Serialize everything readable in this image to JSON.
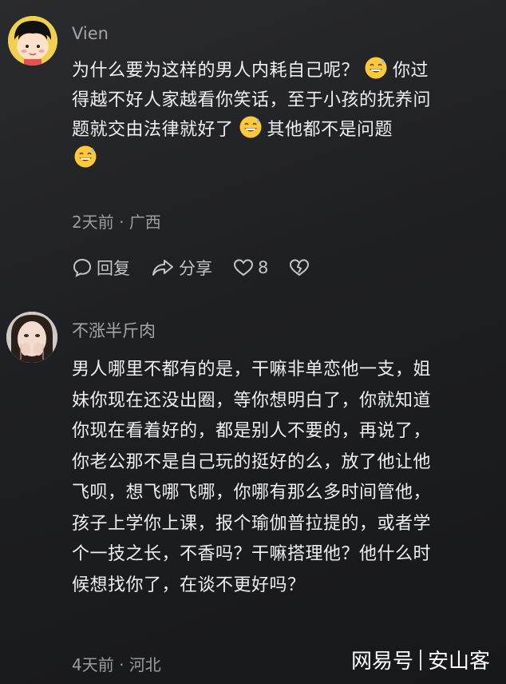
{
  "comments": [
    {
      "username": "Vien",
      "lines": [
        [
          "为什么要为这样的男人内耗自己呢？",
          "emoji",
          "你过"
        ],
        [
          "得越不好人家越看你笑话，至于小孩的抚养问"
        ],
        [
          "题就交由法律就好了",
          "emoji",
          "其他都不是问题"
        ],
        [
          "emoji"
        ]
      ],
      "emoji_icon": "grinning-sweat-emoji-icon",
      "time": "2天前",
      "dot": "·",
      "location": "广西",
      "actions": {
        "reply_label": "回复",
        "share_label": "分享",
        "like_count": "8"
      }
    },
    {
      "username": "不涨半斤肉",
      "lines": [
        [
          "男人哪里不都有的是，干嘛非单恋他一支，姐"
        ],
        [
          "妹你现在还没出圈，等你想明白了，你就知道"
        ],
        [
          "你现在看着好的，都是别人不要的，再说了，"
        ],
        [
          "你老公那不是自己玩的挺好的么，放了他让他"
        ],
        [
          "飞呗，想飞哪飞哪，你哪有那么多时间管他，"
        ],
        [
          "孩子上学你上课，报个瑜伽普拉提的，或者学"
        ],
        [
          "个一技之长，不香吗？干嘛搭理他？他什么时"
        ],
        [
          "候想找你了，在谈不更好吗？"
        ]
      ],
      "time": "4天前",
      "dot": "·",
      "location": "河北"
    }
  ],
  "watermark": {
    "brand": "网易号",
    "author": "安山客"
  },
  "colors": {
    "background": "#1e1f22",
    "text": "#efeff0",
    "muted": "#9c9da0"
  }
}
